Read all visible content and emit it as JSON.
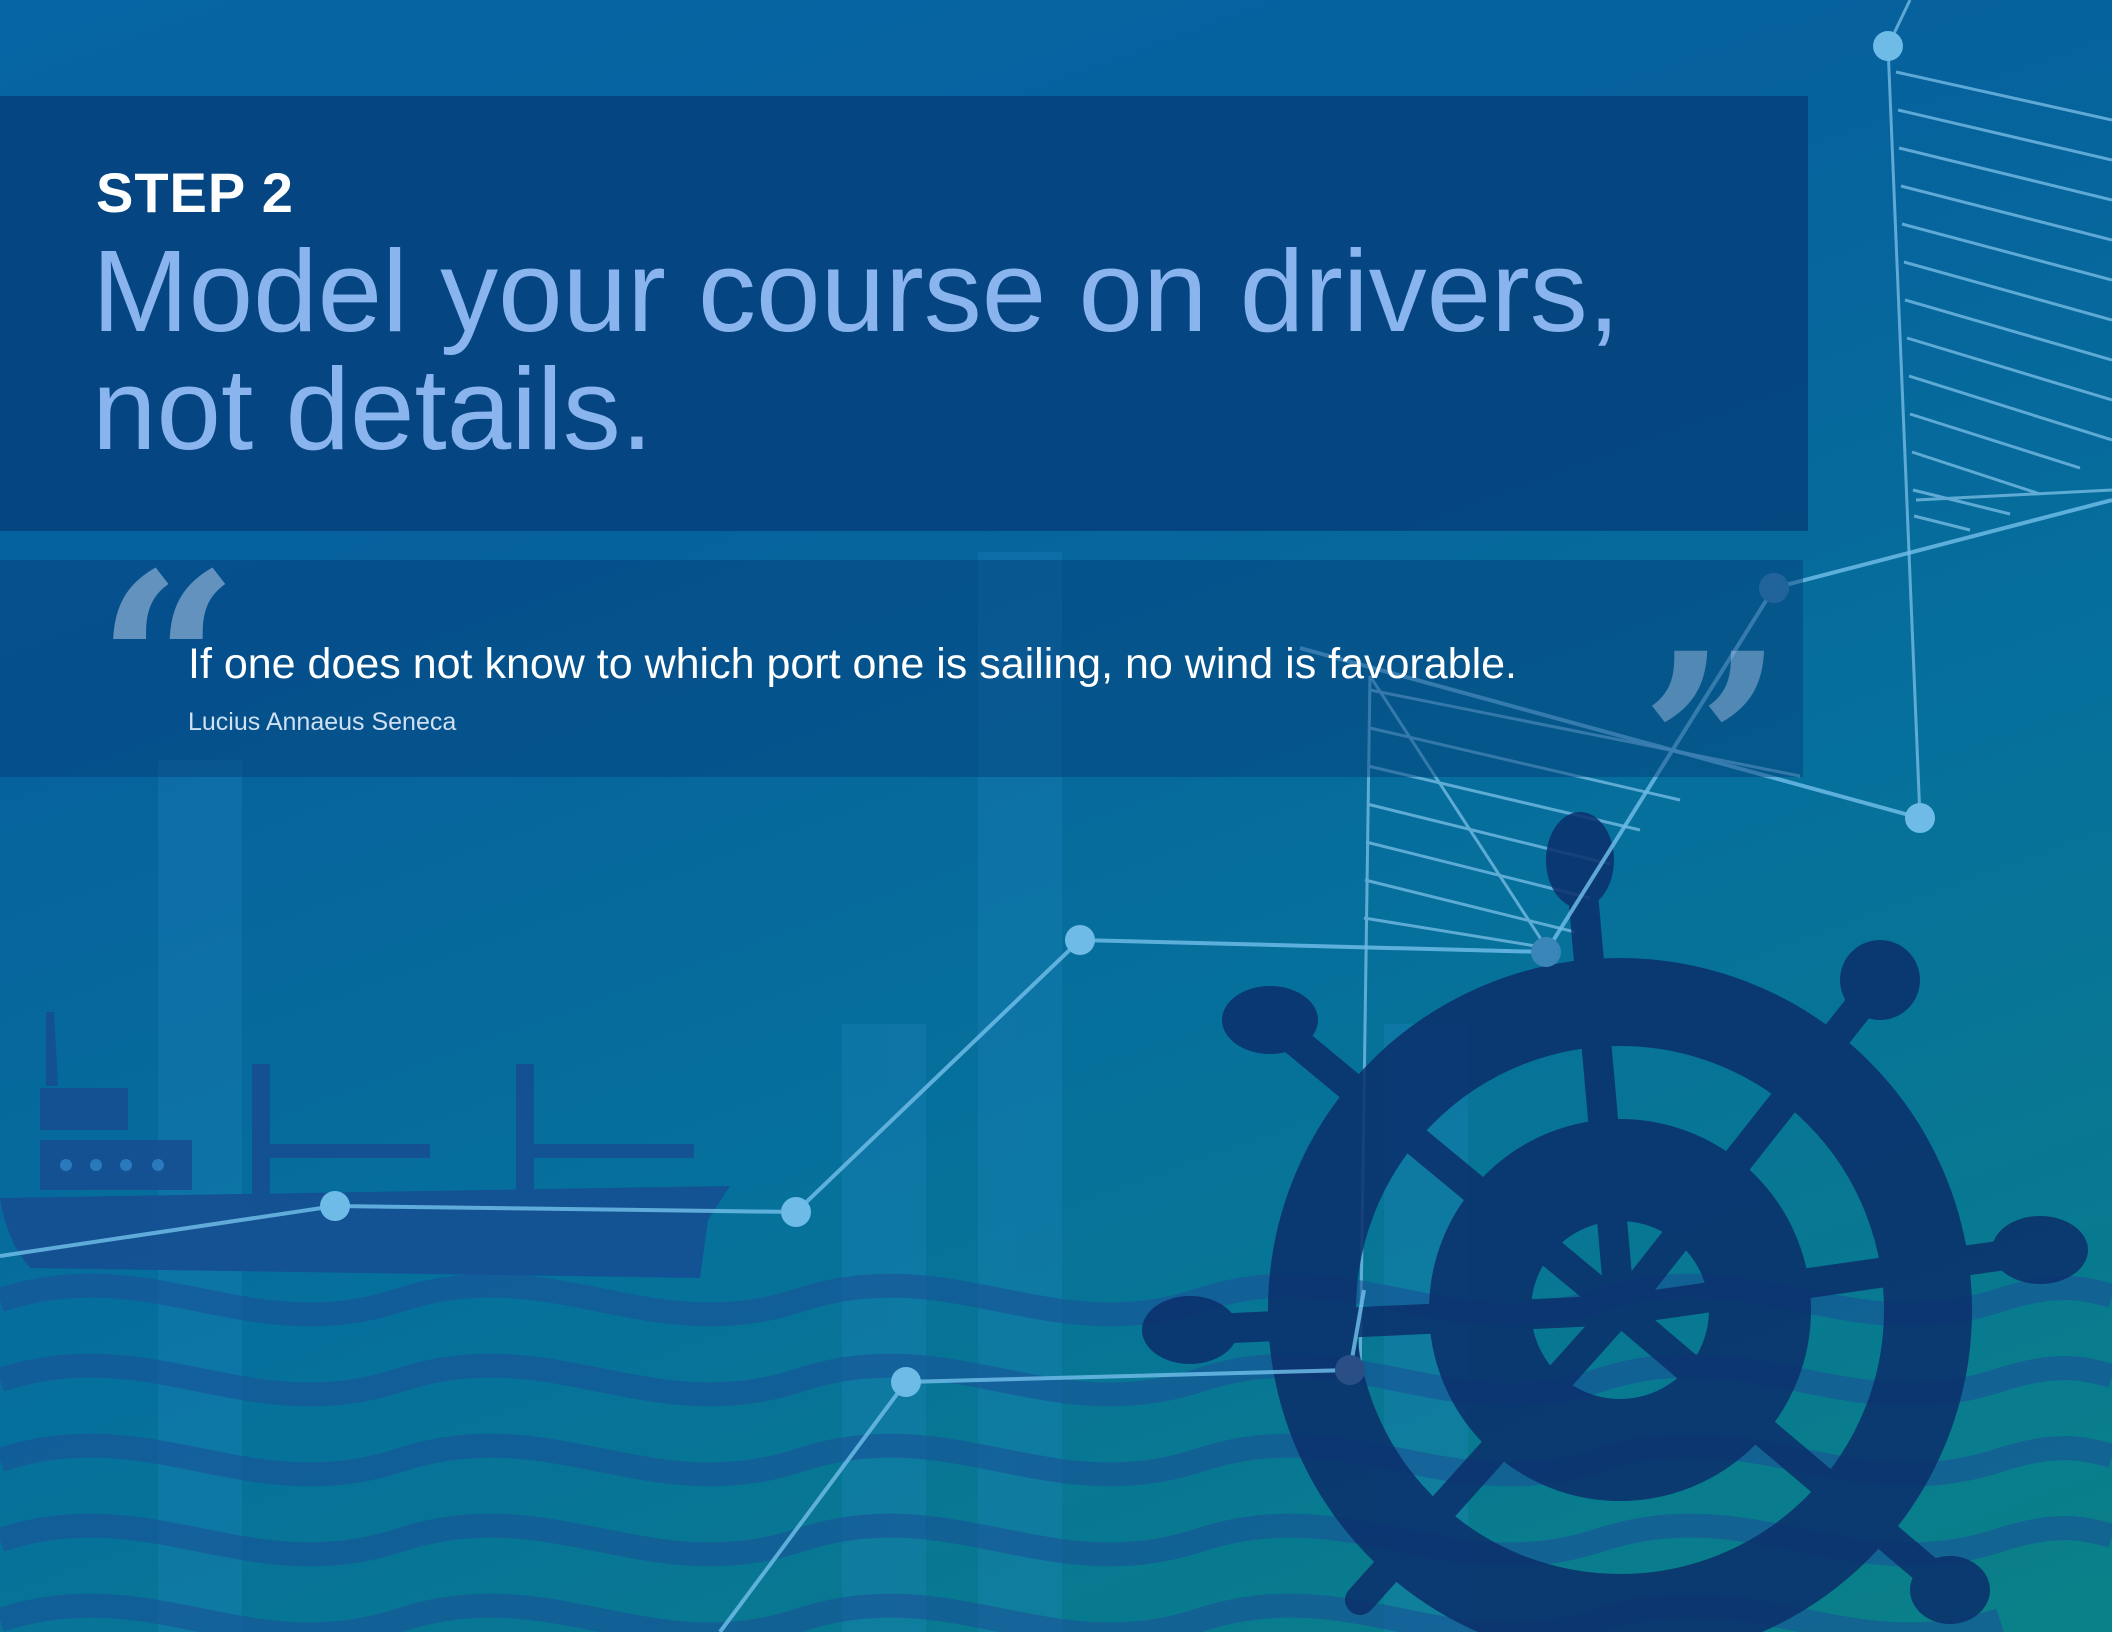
{
  "header": {
    "step_label": "STEP 2",
    "headline": "Model your course on drivers, not details."
  },
  "quote": {
    "open_mark": "“",
    "close_mark": "”",
    "text": "If one does not know to which port one is sailing, no wind is favorable.",
    "author": "Lucius Annaeus Seneca"
  },
  "illustration": {
    "icons": [
      "cargo-ship-icon",
      "ship-wheel-icon",
      "sail-icon"
    ]
  },
  "colors": {
    "background_top": "#0665a4",
    "background_bottom": "#0a8188",
    "panel": "#053a76",
    "headline": "#8ab4ee",
    "text": "#ffffff",
    "chart_line": "#5fb2e0",
    "wheel": "#0b2f6b"
  }
}
